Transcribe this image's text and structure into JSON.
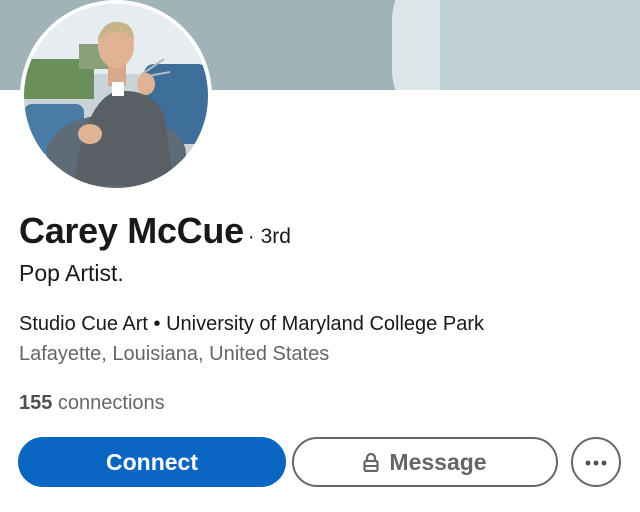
{
  "profile": {
    "name": "Carey McCue",
    "degree": "· 3rd",
    "headline": "Pop Artist.",
    "organization": "Studio Cue Art • University of Maryland College Park",
    "location": "Lafayette, Louisiana, United States",
    "connections_count": "155",
    "connections_label": " connections"
  },
  "actions": {
    "connect_label": "Connect",
    "message_label": "Message",
    "more_icon": "more-horizontal-icon",
    "lock_icon": "lock-icon"
  },
  "colors": {
    "primary": "#0a66c2",
    "text_primary": "#191919",
    "text_secondary": "#666666",
    "banner": "#9fb3b9"
  }
}
